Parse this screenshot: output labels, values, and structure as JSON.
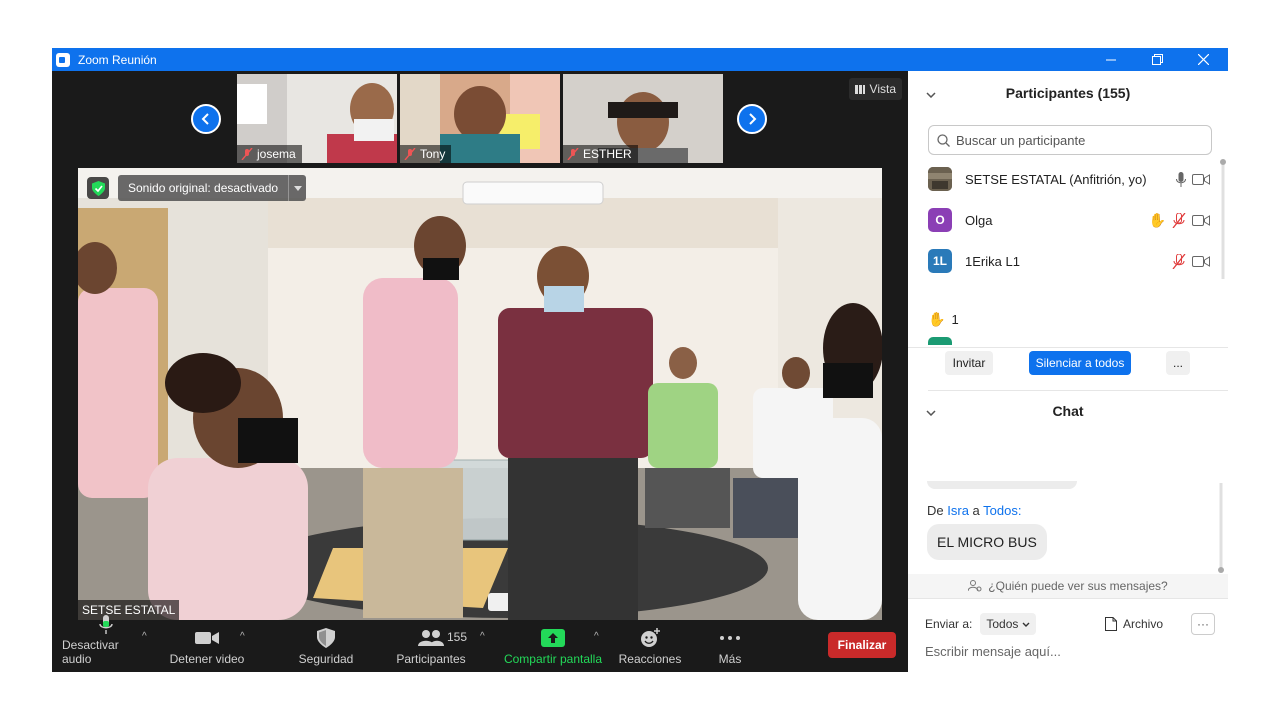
{
  "window": {
    "title": "Zoom Reunión"
  },
  "thumbnails": [
    {
      "name": "josema"
    },
    {
      "name": "Tony"
    },
    {
      "name": "ESTHER"
    }
  ],
  "view_button": {
    "label": "Vista"
  },
  "main_video": {
    "sound_label": "Sonido original: desactivado",
    "speaker_name": "SETSE ESTATAL"
  },
  "toolbar": {
    "mute_label": "Desactivar audio",
    "video_label": "Detener video",
    "security_label": "Seguridad",
    "participants_label": "Participantes",
    "participants_count": "155",
    "share_label": "Compartir pantalla",
    "reactions_label": "Reacciones",
    "more_label": "Más",
    "end_label": "Finalizar"
  },
  "participants": {
    "header": "Participantes (155)",
    "search_placeholder": "Buscar un participante",
    "list": [
      {
        "name": "SETSE ESTATAL (Anfitrión, yo)",
        "avatar": ""
      },
      {
        "name": "Olga",
        "avatar": "O",
        "color": "#8b3fb5"
      },
      {
        "name": "1Erika L1",
        "avatar": "1L",
        "color": "#2a7ab9"
      }
    ],
    "raised_hands": "1",
    "invite_label": "Invitar",
    "mute_all_label": "Silenciar a todos",
    "more_label": "..."
  },
  "chat": {
    "header": "Chat",
    "from_prefix": "De",
    "from": "Isra",
    "to_prefix": "a",
    "to": "Todos:",
    "message": "EL MICRO BUS",
    "who_sees": "¿Quién puede ver sus mensajes?",
    "send_to_label": "Enviar a:",
    "send_to_value": "Todos",
    "file_label": "Archivo",
    "more_label": "···",
    "input_placeholder": "Escribir mensaje aquí..."
  },
  "colors": {
    "brand": "#0e72ed",
    "end_red": "#c92a2a",
    "share_green": "#23d959"
  }
}
